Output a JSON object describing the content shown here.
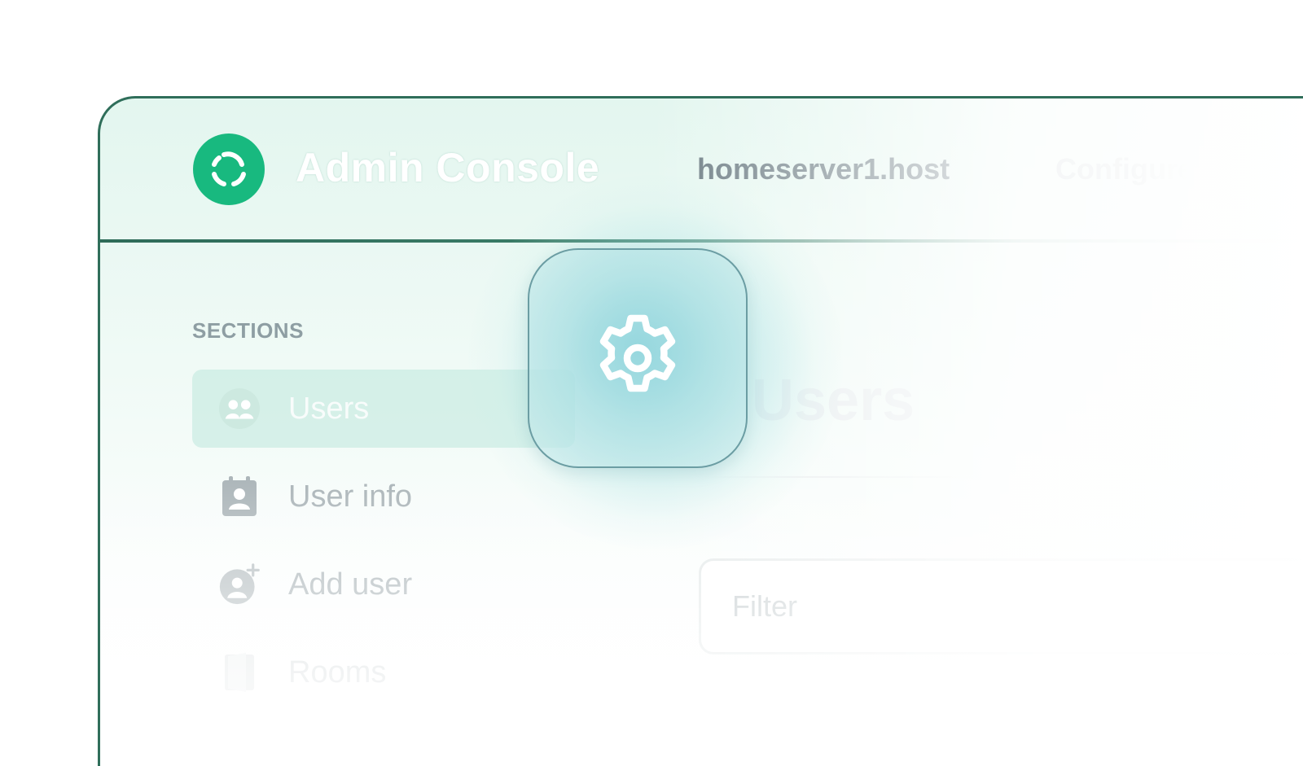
{
  "header": {
    "app_title": "Admin Console",
    "server_name": "homeserver1.host",
    "configure_label": "Configure"
  },
  "sidebar": {
    "section_title": "SECTIONS",
    "items": [
      {
        "label": "Users",
        "icon": "users-icon",
        "active": true
      },
      {
        "label": "User info",
        "icon": "contact-badge-icon",
        "active": false
      },
      {
        "label": "Add user",
        "icon": "add-user-icon",
        "active": false
      },
      {
        "label": "Rooms",
        "icon": "door-icon",
        "active": false
      }
    ]
  },
  "main": {
    "heading": "Users",
    "filter_placeholder": "Filter"
  },
  "overlay": {
    "icon": "gear-icon"
  },
  "colors": {
    "brand": "#18b97f",
    "frame_border": "#2f6e5a",
    "muted_text": "#a9b3b7"
  }
}
